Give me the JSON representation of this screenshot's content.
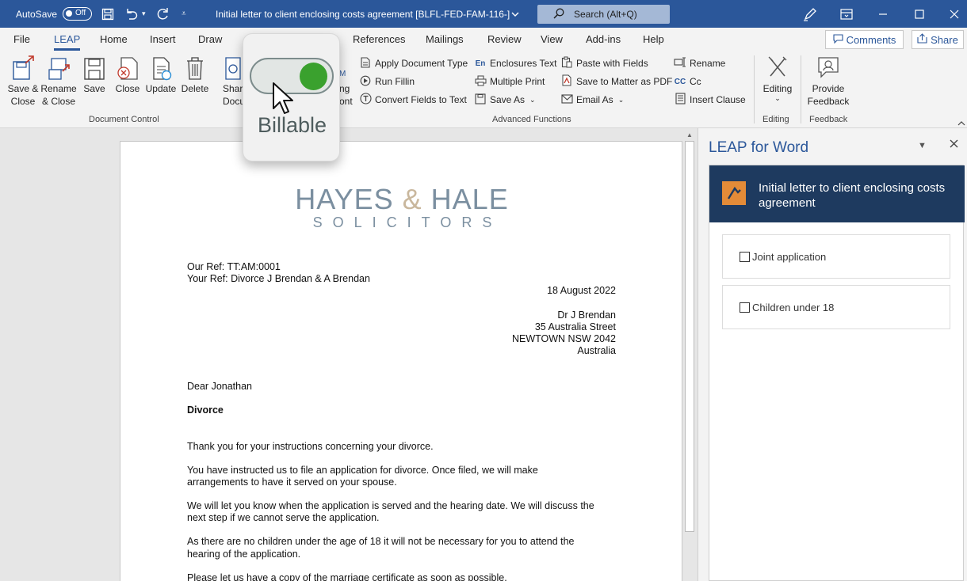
{
  "titlebar": {
    "autosave_label": "AutoSave",
    "autosave_state": "Off",
    "doc_title": "Initial letter to client enclosing costs agreement [BLFL-FED-FAM-116-]",
    "search_placeholder": "Search (Alt+Q)"
  },
  "tabs": [
    "File",
    "LEAP",
    "Home",
    "Insert",
    "Draw",
    "References",
    "Mailings",
    "Review",
    "View",
    "Add-ins",
    "Help"
  ],
  "tab_active": "LEAP",
  "actions": {
    "comments": "Comments",
    "share": "Share"
  },
  "ribbon": {
    "doc_control": {
      "label": "Document Control",
      "buttons": [
        "Save &\nClose",
        "Rename\n& Close",
        "Save",
        "Close",
        "Update",
        "Delete",
        "Shar\nDocum"
      ],
      "partial": [
        "ng",
        "ont"
      ]
    },
    "advanced": {
      "label": "Advanced Functions",
      "col1": [
        "Apply Document Type",
        "Run Fillin",
        "Convert Fields to Text"
      ],
      "col2": [
        "Enclosures Text",
        "Multiple Print",
        "Save As"
      ],
      "col3": [
        "Paste with Fields",
        "Save to Matter as PDF",
        "Email As"
      ],
      "col4": [
        "Rename",
        "Cc",
        "Insert Clause"
      ]
    },
    "editing": {
      "button": "Editing",
      "label": "Editing"
    },
    "feedback": {
      "button": "Provide\nFeedback",
      "label": "Feedback"
    }
  },
  "billable": {
    "label": "Billable",
    "state": "on"
  },
  "document": {
    "logo_line1_a": "HAYES ",
    "logo_amp": "&",
    "logo_line1_b": " HALE",
    "logo_line2": "SOLICITORS",
    "our_ref": "Our Ref: TT:AM:0001",
    "your_ref": "Your Ref: Divorce J Brendan & A Brendan",
    "date": "18 August 2022",
    "address": [
      "Dr J Brendan",
      "35 Australia Street",
      "NEWTOWN  NSW  2042",
      "Australia"
    ],
    "salutation": "Dear Jonathan",
    "subject": "Divorce",
    "paragraphs": [
      [
        "Thank you for your instructions concerning your divorce."
      ],
      [
        "You have instructed us to file an application for divorce. Once filed, we will make",
        "arrangements to have it served on your spouse."
      ],
      [
        "We will let you know when the application is served and the hearing date. We will discuss the",
        "next step if we cannot serve the application."
      ],
      [
        "As there are no children under the age of 18 it will not be necessary for you to attend the",
        "hearing of the application."
      ],
      [
        "Please let us have a copy of the marriage certificate as soon as possible."
      ]
    ]
  },
  "pane": {
    "title": "LEAP for Word",
    "header": "Initial letter to client enclosing costs agreement",
    "checkboxes": [
      "Joint application",
      "Children under 18"
    ]
  }
}
